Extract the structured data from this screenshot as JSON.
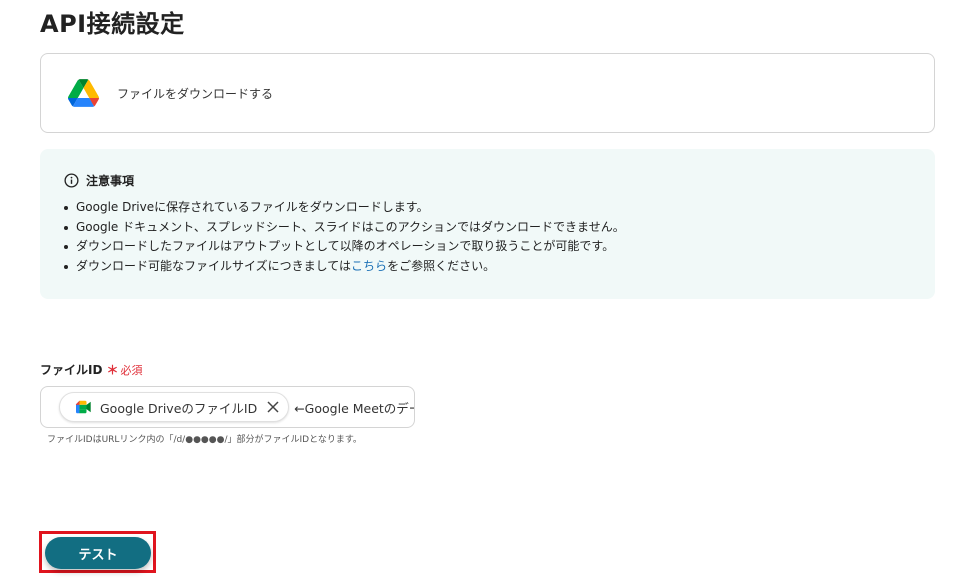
{
  "page": {
    "title": "API接続設定"
  },
  "action": {
    "icon": "google-drive-icon",
    "label": "ファイルをダウンロードする"
  },
  "notice": {
    "icon": "info-icon",
    "heading": "注意事項",
    "items": [
      "Google Driveに保存されているファイルをダウンロードします。",
      "Google ドキュメント、スプレッドシート、スライドはこのアクションではダウンロードできません。",
      "ダウンロードしたファイルはアウトプットとして以降のオペレーションで取り扱うことが可能です。"
    ],
    "last_item": {
      "before": "ダウンロード可能なファイルサイズにつきましては",
      "link": "こちら",
      "after": "をご参照ください。"
    }
  },
  "field": {
    "label": "ファイルID",
    "required_mark": "＊",
    "required_text": "必須",
    "chip": {
      "icon": "google-meet-icon",
      "label": "Google DriveのファイルID",
      "close_icon": "close-icon"
    },
    "suffix_text": "←Google Meetのデータからファイル",
    "hint": "ファイルIDはURLリンク内の「/d/●●●●●/」部分がファイルIDとなります。"
  },
  "test_button": {
    "label": "テスト",
    "color": "#126e82",
    "highlight_color": "#e0141e"
  }
}
